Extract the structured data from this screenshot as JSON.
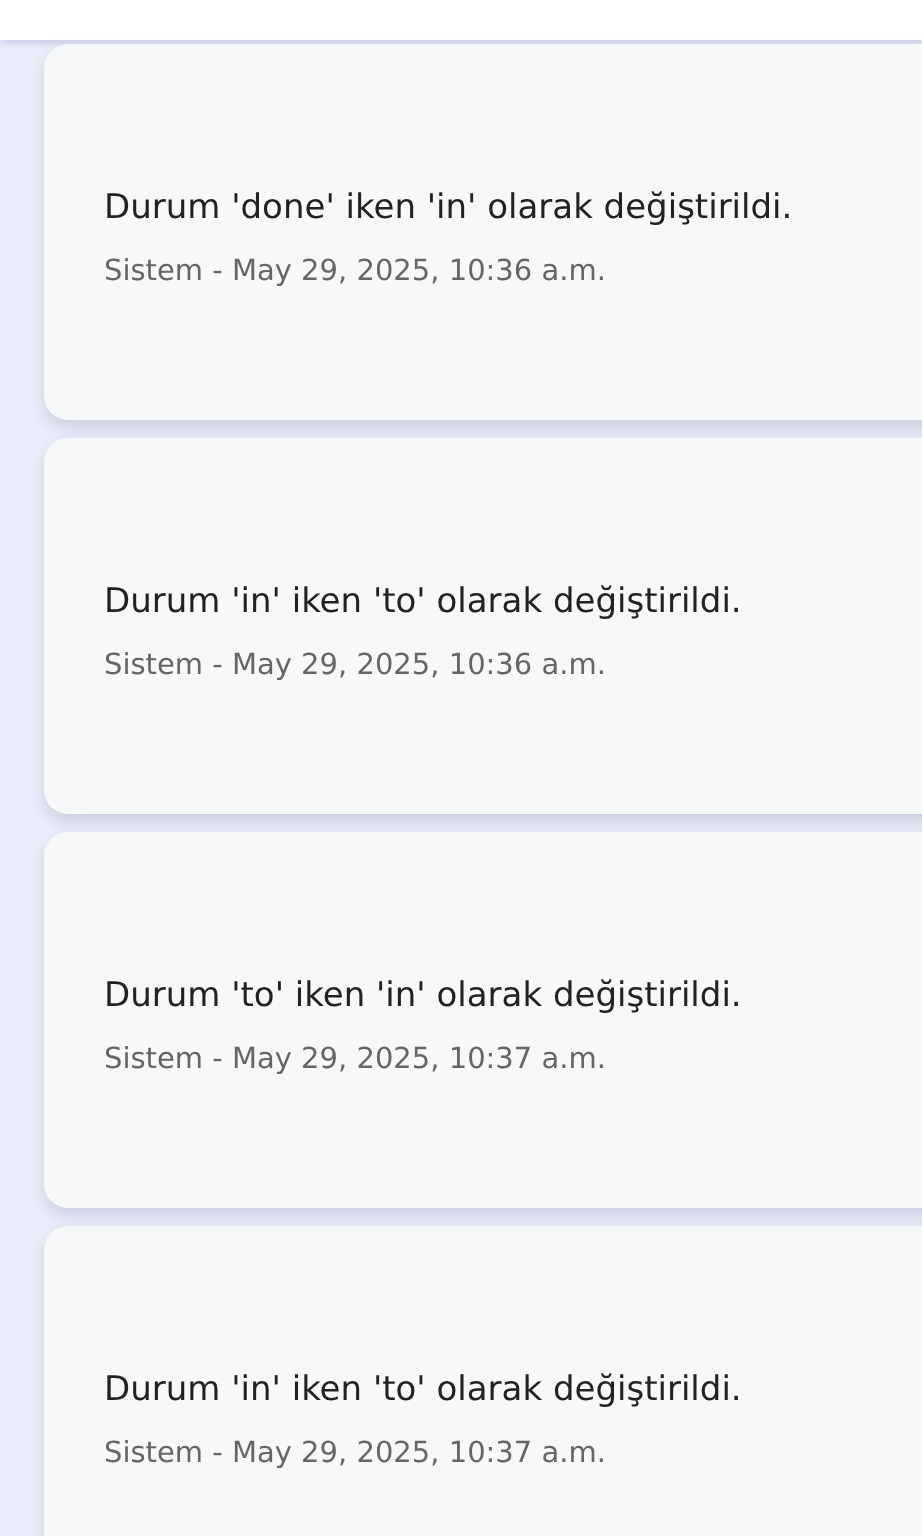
{
  "entries": [
    {
      "message": "Durum 'done' iken 'in' olarak değiştirildi.",
      "meta": "Sistem - May 29, 2025, 10:36 a.m."
    },
    {
      "message": "Durum 'in' iken 'to' olarak değiştirildi.",
      "meta": "Sistem - May 29, 2025, 10:36 a.m."
    },
    {
      "message": "Durum 'to' iken 'in' olarak değiştirildi.",
      "meta": "Sistem - May 29, 2025, 10:37 a.m."
    },
    {
      "message": "Durum 'in' iken 'to' olarak değiştirildi.",
      "meta": "Sistem - May 29, 2025, 10:37 a.m."
    }
  ]
}
